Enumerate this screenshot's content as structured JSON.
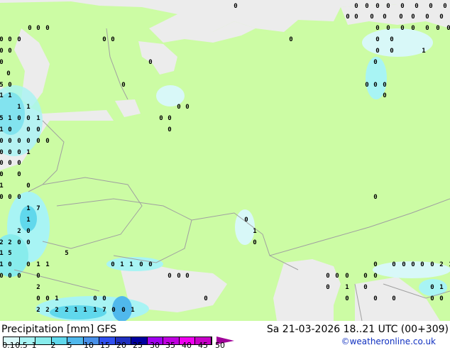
{
  "title": {
    "label": "Precipitation [mm]",
    "model": "GFS"
  },
  "valid_time": "Sa 21-03-2026 18..21 UTC (00+309)",
  "credit": "©weatheronline.co.uk",
  "legend": {
    "ticks": [
      "0.1",
      "0.5",
      "1",
      "2",
      "5",
      "10",
      "15",
      "20",
      "25",
      "30",
      "35",
      "40",
      "45",
      "50"
    ],
    "colors": [
      "#d8f8f8",
      "#a8f4f4",
      "#88ecec",
      "#60d8ec",
      "#50b8ec",
      "#4890e8",
      "#3050f0",
      "#2030c0",
      "#0000a0",
      "#a000f0",
      "#c000e0",
      "#f000f0",
      "#c800c8"
    ],
    "arrow_color": "#a00098"
  },
  "colors": {
    "land": "#ccfca4",
    "sea": "#ececec",
    "border": "#a0a0a0"
  },
  "station_values": [
    "0",
    "0",
    "0",
    "0",
    "0",
    "0",
    "0",
    "0",
    "0",
    "0",
    "0",
    "0",
    "0",
    "0",
    "0",
    "0",
    "0",
    "0",
    "0",
    "0",
    "0",
    "0",
    "0",
    "0",
    "0",
    "0",
    "0",
    "0",
    "0",
    "0",
    "0",
    "0",
    "0",
    "0",
    "0",
    "1",
    "0",
    "0",
    "0",
    "0",
    "0",
    "0",
    "0",
    "0",
    "5",
    "0",
    "0",
    "0",
    "0",
    "0",
    "0",
    "1",
    "1",
    "1",
    "1",
    "0",
    "0",
    "5",
    "1",
    "0",
    "0",
    "1",
    "0",
    "0",
    "1",
    "0",
    "0",
    "0",
    "0",
    "0",
    "0",
    "0",
    "0",
    "0",
    "0",
    "0",
    "0",
    "0",
    "1",
    "0",
    "0",
    "0",
    "0",
    "0",
    "1",
    "0",
    "0",
    "0",
    "0",
    "0",
    "1",
    "7",
    "1",
    "0",
    "2",
    "0",
    "1",
    "2",
    "2",
    "0",
    "0",
    "0",
    "5",
    "1",
    "5",
    "1",
    "0",
    "0",
    "1",
    "1",
    "0",
    "1",
    "1",
    "0",
    "0",
    "0",
    "0",
    "0",
    "0",
    "0",
    "0",
    "2",
    "1",
    "0",
    "0",
    "0",
    "0",
    "0",
    "0",
    "0",
    "0",
    "0",
    "0",
    "0",
    "0",
    "0",
    "1",
    "2",
    "0",
    "1",
    "0",
    "0",
    "0",
    "1",
    "0",
    "0",
    "0",
    "0",
    "0",
    "0",
    "0",
    "0",
    "2",
    "2",
    "2",
    "2",
    "1",
    "1",
    "1",
    "7",
    "0",
    "0",
    "1"
  ]
}
